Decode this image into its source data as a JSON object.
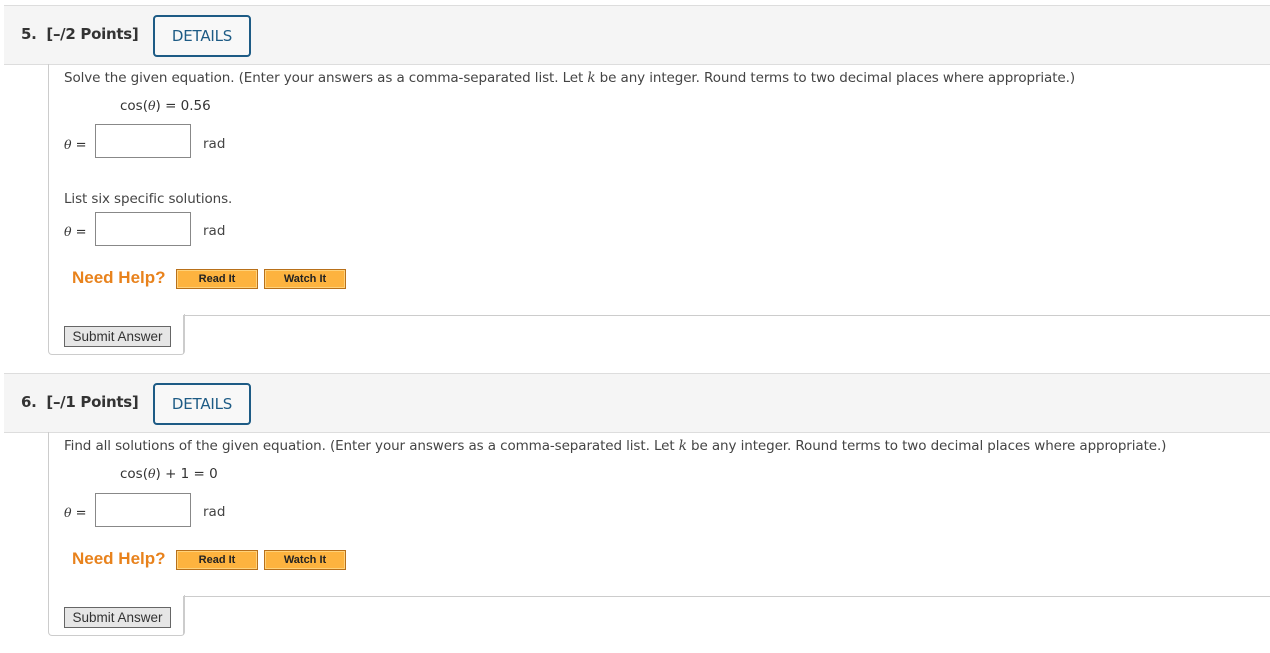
{
  "questions": [
    {
      "number_label": "5.",
      "points_label": "[–/2 Points]",
      "details_label": "DETAILS",
      "prompt_before_k": "Solve the given equation. (Enter your answers as a comma-separated list. Let ",
      "prompt_k": "k",
      "prompt_after_k": " be any integer. Round terms to two decimal places where appropriate.)",
      "equation_prefix": "cos(",
      "equation_var": "θ",
      "equation_suffix": ") = 0.56",
      "parts": [
        {
          "intro": "",
          "var": "θ",
          "eq": " =",
          "value": "",
          "unit": "rad"
        },
        {
          "intro": "List six specific solutions.",
          "var": "θ",
          "eq": " =",
          "value": "",
          "unit": "rad"
        }
      ],
      "need_help_label": "Need Help?",
      "read_it_label": "Read It",
      "watch_it_label": "Watch It",
      "submit_label": "Submit Answer"
    },
    {
      "number_label": "6.",
      "points_label": "[–/1 Points]",
      "details_label": "DETAILS",
      "prompt_before_k": "Find all solutions of the given equation. (Enter your answers as a comma-separated list. Let ",
      "prompt_k": "k",
      "prompt_after_k": " be any integer. Round terms to two decimal places where appropriate.)",
      "equation_prefix": "cos(",
      "equation_var": "θ",
      "equation_suffix": ") + 1 = 0",
      "parts": [
        {
          "intro": "",
          "var": "θ",
          "eq": " =",
          "value": "",
          "unit": "rad"
        }
      ],
      "need_help_label": "Need Help?",
      "read_it_label": "Read It",
      "watch_it_label": "Watch It",
      "submit_label": "Submit Answer"
    }
  ],
  "colors": {
    "details_accent": "#1d5b85",
    "need_help": "#e8821c",
    "help_button": "#fdb33f"
  }
}
